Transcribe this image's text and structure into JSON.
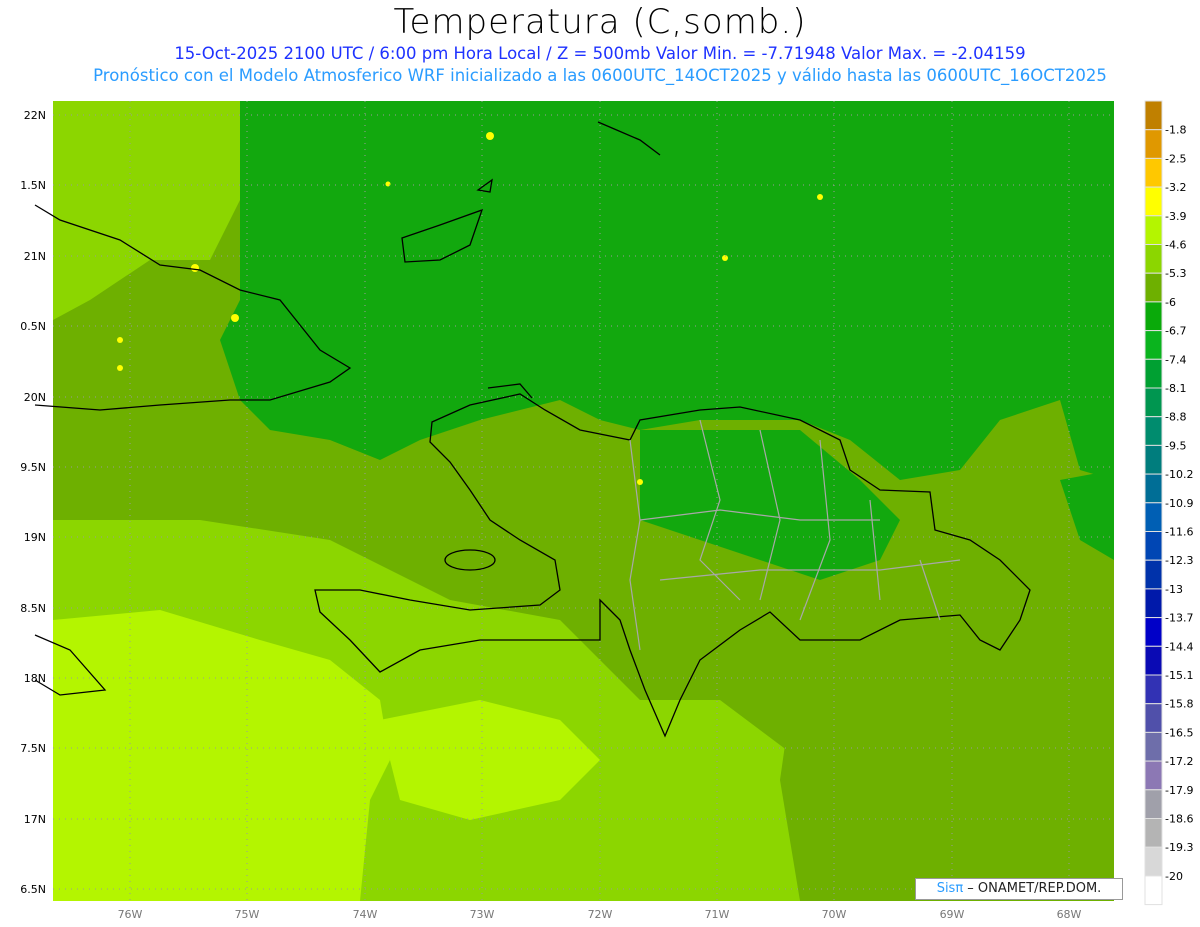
{
  "title": "Temperatura (C,somb.)",
  "subtitle1": "15-Oct-2025   2100 UTC / 6:00 pm Hora Local / Z = 500mb   Valor Min. = -7.71948   Valor Max. = -2.04159",
  "subtitle2": "Pronóstico con el Modelo Atmosferico WRF inicializado a las 0600UTC_14OCT2025 y válido hasta las  0600UTC_16OCT2025",
  "lat_labels": [
    "22N",
    "1.5N",
    "21N",
    "0.5N",
    "20N",
    "9.5N",
    "19N",
    "8.5N",
    "18N",
    "7.5N",
    "17N",
    "6.5N"
  ],
  "lon_labels": [
    "76W",
    "75W",
    "74W",
    "73W",
    "72W",
    "71W",
    "70W",
    "69W",
    "68W"
  ],
  "colorbar": {
    "labels": [
      "-1.8",
      "-2.5",
      "-3.2",
      "-3.9",
      "-4.6",
      "-5.3",
      "-6",
      "-6.7",
      "-7.4",
      "-8.1",
      "-8.8",
      "-9.5",
      "-10.2",
      "-10.9",
      "-11.6",
      "-12.3",
      "-13",
      "-13.7",
      "-14.4",
      "-15.1",
      "-15.8",
      "-16.5",
      "-17.2",
      "-17.9",
      "-18.6",
      "-19.3",
      "-20"
    ],
    "colors": [
      "#c08000",
      "#e09800",
      "#ffc800",
      "#ffff00",
      "#b4f500",
      "#8cd600",
      "#6eb000",
      "#0aaa0a",
      "#0ab41e",
      "#00a032",
      "#009650",
      "#008c6e",
      "#007d7d",
      "#006e96",
      "#005fb4",
      "#0046b4",
      "#0032aa",
      "#0019aa",
      "#0000c8",
      "#0a0ab4",
      "#3232b4",
      "#5050aa",
      "#6e6eaa",
      "#8c78b4",
      "#a0a0aa",
      "#b4b4b4",
      "#d8d8d8",
      "#ffffff"
    ]
  },
  "credit": {
    "brand": "Sisπ",
    "text": " –  ONAMET/REP.DOM."
  }
}
